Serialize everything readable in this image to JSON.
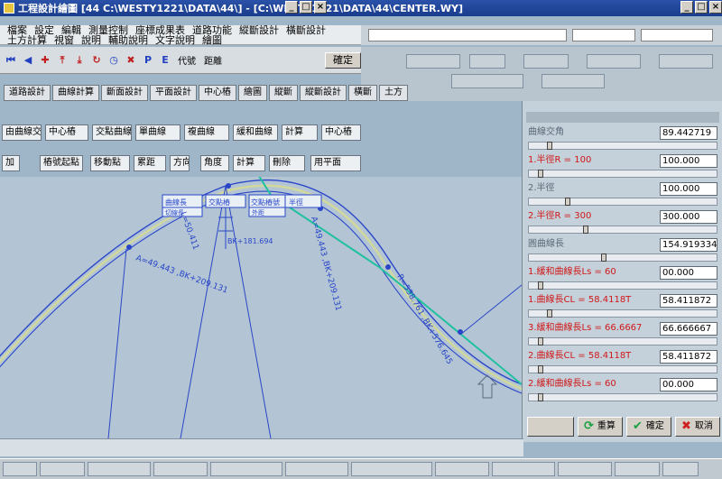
{
  "window": {
    "title": "工程設計繪圖 [44 C:\\WESTY1221\\DATA\\44\\] - [C:\\WESTY1221\\DATA\\44\\CENTER.WY]",
    "minimize_label": "_",
    "maximize_label": "□",
    "close_label": "×"
  },
  "menu": {
    "items": [
      "檔案",
      "設定",
      "編輯",
      "測量控制",
      "座標成果表",
      "道路功能",
      "縱斷設計",
      "橫斷設計",
      "土方計算",
      "視窗",
      "說明",
      "輔助說明",
      "文字說明",
      "繪圖"
    ]
  },
  "toolbar": {
    "label_a": "代號",
    "label_b": "距離",
    "pushbutton": "確定"
  },
  "tabs": [
    "道路設計",
    "曲線計算",
    "斷面設計",
    "平面設計",
    "中心樁",
    "繪圖",
    "縱斷",
    "縱斷設計",
    "橫斷",
    "土方"
  ],
  "commands": {
    "row1": [
      "由曲線交點",
      "中心樁",
      "交點曲線",
      "單曲線",
      "複曲線",
      "緩和曲線",
      "計算",
      "中心樁"
    ],
    "row2": [
      "加",
      "樁號起點",
      "移動點",
      "累距",
      "方向",
      "角度",
      "計算",
      "刪除",
      "用平面"
    ]
  },
  "canvas_labels": {
    "curve_annotation_1": "A=49.443 ,BK+209.131",
    "curve_annotation_2": "BK+181.694",
    "curve_annotation_3": "L=50.411",
    "curve_annotation_4": "A=49.443 ,BK+209.131",
    "curve_annotation_5": "R=538.761 ,BK+576.645",
    "box_1": "曲線長",
    "box_2": "交點樁",
    "box_3": "交點樁號",
    "box_4": "半徑",
    "box_5": "切線長",
    "box_6": "外距"
  },
  "panel": {
    "params": [
      {
        "label": "曲線交角",
        "value": "89.442719",
        "dim": true,
        "thumb": 0.1
      },
      {
        "label": "1.半徑R = 100",
        "value": "100.000",
        "dim": false,
        "thumb": 0.05
      },
      {
        "label": "2.半徑",
        "value": "100.000",
        "dim": true,
        "thumb": 0.2
      },
      {
        "label": "2.半徑R = 300",
        "value": "300.000",
        "dim": false,
        "thumb": 0.3
      },
      {
        "label": "圓曲線長",
        "value": "154.919334",
        "dim": true,
        "thumb": 0.4
      },
      {
        "label": "1.緩和曲線長Ls = 60",
        "value": "00.000",
        "dim": false,
        "thumb": 0.05
      },
      {
        "label": "1.曲線長CL = 58.4118T",
        "value": "58.411872",
        "dim": false,
        "thumb": 0.1
      },
      {
        "label": "3.緩和曲線長Ls = 66.6667",
        "value": "66.666667",
        "dim": false,
        "thumb": 0.05
      },
      {
        "label": "2.曲線長CL = 58.4118T",
        "value": "58.411872",
        "dim": false,
        "thumb": 0.05
      },
      {
        "label": "2.緩和曲線長Ls = 60",
        "value": "00.000",
        "dim": false,
        "thumb": 0.05
      }
    ],
    "btn_cancel_label": "",
    "btn_refresh_label": "重算",
    "btn_ok_label": "確定",
    "btn_close_label": "取消"
  },
  "colors": {
    "curve": "#2a46c8",
    "centerline_green": "#20c0a0",
    "marker_red": "#e02020",
    "canvas_bg": "#b3c5d4"
  }
}
